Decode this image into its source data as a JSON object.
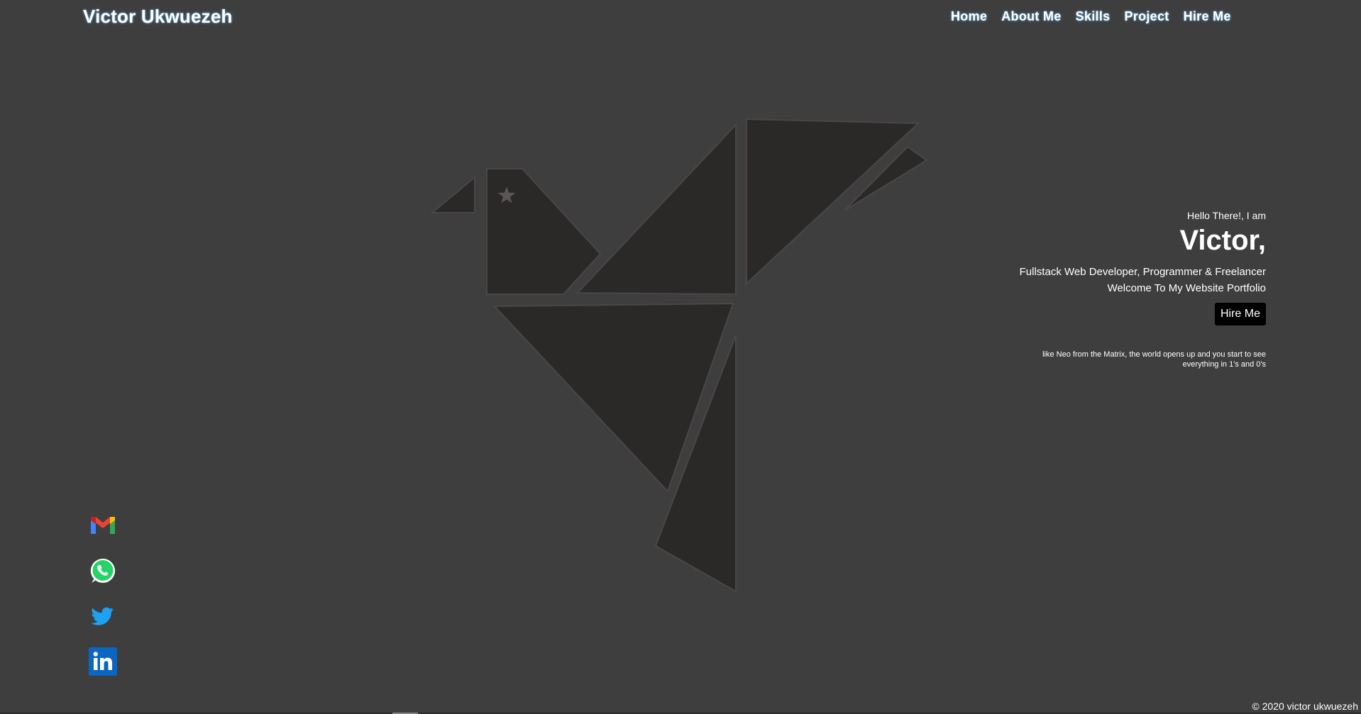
{
  "header": {
    "brand": "Victor Ukwuezeh",
    "nav": [
      "Home",
      "About Me",
      "Skills",
      "Project",
      "Hire Me"
    ]
  },
  "hero": {
    "greeting": "Hello There!, I am",
    "name": "Victor,",
    "role": "Fullstack Web Developer, Programmer & Freelancer",
    "welcome": "Welcome To My Website Portfolio",
    "button_label": "Hire Me",
    "quote": "like Neo from the Matrix, the world opens up and you start to see everything in 1's and 0's"
  },
  "socials": [
    {
      "icon": "gmail-icon"
    },
    {
      "icon": "whatsapp-icon"
    },
    {
      "icon": "twitter-icon"
    },
    {
      "icon": "linkedin-icon"
    }
  ],
  "footer": {
    "copyright": "© 2020 victor ukwuezeh"
  },
  "colors": {
    "background": "#3e3e3e",
    "bird_fill": "#2b2828",
    "nav_glow": "#6fb6e6",
    "button_bg": "#000000"
  }
}
